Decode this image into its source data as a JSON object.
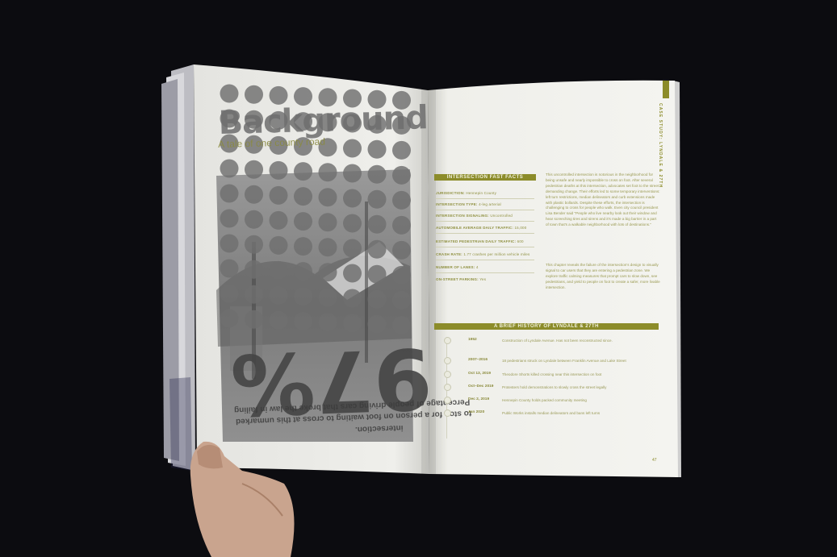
{
  "left_page": {
    "title": "Background",
    "subtitle": "A tale of one county road",
    "big_number": "97%",
    "caption_lines": [
      "Percentage of people driving cars that broke the law in failing",
      "to stop for a person on foot waiting to cross at this unmarked",
      "intersection."
    ]
  },
  "right_page": {
    "side_tab": "CASE STUDY: LYNDALE & 27TH",
    "facts_header": "INTERSECTION FAST FACTS",
    "facts": [
      {
        "label": "JURISDICTION:",
        "value": "Hennepin County"
      },
      {
        "label": "INTERSECTION TYPE:",
        "value": "4-leg arterial"
      },
      {
        "label": "INTERSECTION SIGNALING:",
        "value": "Uncontrolled"
      },
      {
        "label": "AUTOMOBILE AVERAGE DAILY TRAFFIC:",
        "value": "15,000"
      },
      {
        "label": "ESTIMATED PEDESTRIAN DAILY TRAFFIC:",
        "value": "600"
      },
      {
        "label": "CRASH RATE:",
        "value": "1.77 crashes per million vehicle miles"
      },
      {
        "label": "NUMBER OF LANES:",
        "value": "4"
      },
      {
        "label": "ON-STREET PARKING:",
        "value": "Yes"
      }
    ],
    "paragraph_1": "This uncontrolled intersection is notorious in the neighborhood for being unsafe and nearly impossible to cross on foot. After several pedestrian deaths at this intersection, advocates set foot to the street demanding change. Their efforts led to some temporary interventions: left turn restrictions, median delineators and curb extensions made with plastic bollards. Despite these efforts, the intersection is challenging to cross for people who walk. Even city council president Lisa Bender said \"People who live nearby look out their window and hear screeching tires and sirens and it's made a big barrier in a part of town that's a walkable neighborhood with lots of destinations.\"",
    "paragraph_2": "This chapter reveals the failure of the intersection's design to visually signal to car users that they are entering a pedestrian zone. We explore traffic calming measures that prompt cars to slow down, see pedestrians, and yield to people on foot to create a safer, more livable intersection.",
    "history_header": "A BRIEF HISTORY OF LYNDALE & 27TH",
    "timeline": [
      {
        "year": "1952",
        "event": "Construction of Lyndale Avenue. Has not been reconstructed since."
      },
      {
        "year": "2007–2016",
        "event": "18 pedestrians struck on Lyndale between Franklin Avenue and Lake Street"
      },
      {
        "year": "Oct 13, 2019",
        "event": "Theodore Shorts killed crossing near this intersection on foot"
      },
      {
        "year": "Oct–Dec 2019",
        "event": "Protesters hold demonstrations to slowly cross the street legally"
      },
      {
        "year": "Dec 2, 2019",
        "event": "Hennepin County holds packed community meeting"
      },
      {
        "year": "Jan 2020",
        "event": "Public Works installs median delineators and bans left turns"
      }
    ],
    "page_number": "47"
  },
  "colors": {
    "background": "#0c0c10",
    "paper": "#f1f1ec",
    "accent": "#8c8c2a",
    "photo_overlay": "#8a8a8a",
    "dots": "#6f6f6f"
  }
}
